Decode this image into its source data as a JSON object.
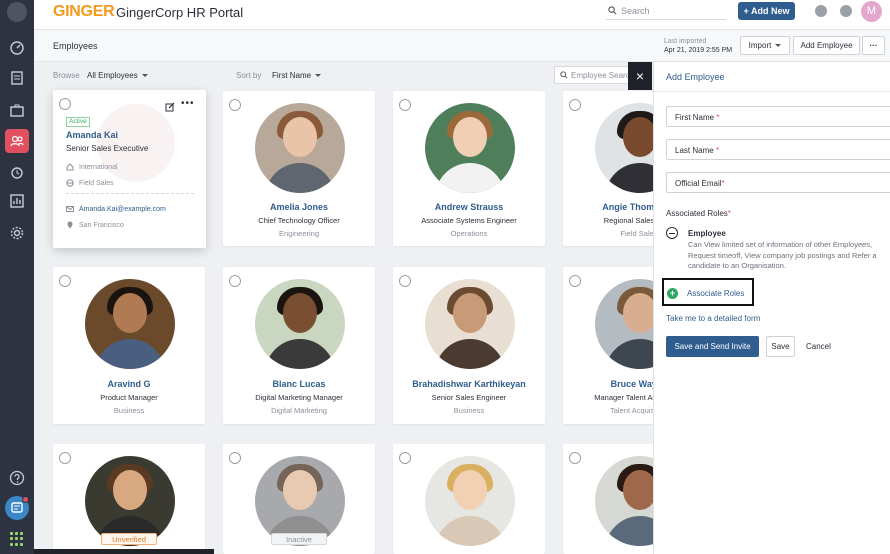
{
  "app": {
    "brand": "GINGER",
    "portal_title": "GingerCorp HR Portal",
    "avatar_initial": "M"
  },
  "topbar": {
    "search_placeholder": "Search",
    "add_new_label": "+ Add New"
  },
  "page": {
    "title": "Employees",
    "last_imported_label": "Last imported",
    "last_imported_value": "Apr 21, 2019 2:55 PM",
    "import_label": "Import",
    "add_employee_label": "Add Employee",
    "more_label": "···"
  },
  "filters": {
    "browse_label": "Browse",
    "browse_value": "All Employees",
    "sort_label": "Sort by",
    "sort_value": "First Name",
    "search_placeholder": "Employee Search"
  },
  "expanded_card": {
    "status": "Active",
    "name": "Amanda Kai",
    "title": "Senior Sales Executive",
    "location_type": "International",
    "department": "Field Sales",
    "email": "Amanda.Kai@example.com",
    "city": "San Francisco"
  },
  "employees": [
    {
      "name": "Amelia Jones",
      "title": "Chief Technology Officer",
      "dept": "Engineering",
      "status": ""
    },
    {
      "name": "Andrew Strauss",
      "title": "Associate Systems Engineer",
      "dept": "Operations",
      "status": ""
    },
    {
      "name": "Angie Thompson",
      "title": "Regional Sales Head",
      "dept": "Field Sales",
      "status": ""
    },
    {
      "name": "Aravind G",
      "title": "Product Manager",
      "dept": "Business",
      "status": ""
    },
    {
      "name": "Blanc Lucas",
      "title": "Digital Marketing Manager",
      "dept": "Digital Marketing",
      "status": ""
    },
    {
      "name": "Brahadishwar Karthikeyan",
      "title": "Senior Sales Engineer",
      "dept": "Business",
      "status": ""
    },
    {
      "name": "Bruce Wayne",
      "title": "Manager Talent Acquisition",
      "dept": "Talent Acquisition",
      "status": ""
    },
    {
      "name": "",
      "title": "",
      "dept": "",
      "status": "Unverified"
    },
    {
      "name": "",
      "title": "",
      "dept": "",
      "status": "Inactive"
    },
    {
      "name": "",
      "title": "",
      "dept": "",
      "status": ""
    },
    {
      "name": "",
      "title": "",
      "dept": "",
      "status": ""
    }
  ],
  "panel": {
    "title": "Add Employee",
    "first_name": "First Name",
    "last_name": "Last Name",
    "official_email": "Official Email",
    "req": "*",
    "associated_roles_label": "Associated Roles",
    "role_name": "Employee",
    "role_description": "Can View limited set of information of other Employees, Request timeoff, View company job postings and Refer a candidate to an Organisation.",
    "associate_roles_label": "Associate Roles",
    "detailed_form_link": "Take me to a detailed form",
    "save_send_label": "Save and Send Invite",
    "save_label": "Save",
    "cancel_label": "Cancel",
    "close_glyph": "×"
  },
  "colors": {
    "accent": "#2f5d8e",
    "brand": "#f49a1c",
    "sidebar": "#2d3340",
    "active_nav": "#e0505f",
    "success": "#2ea664"
  }
}
